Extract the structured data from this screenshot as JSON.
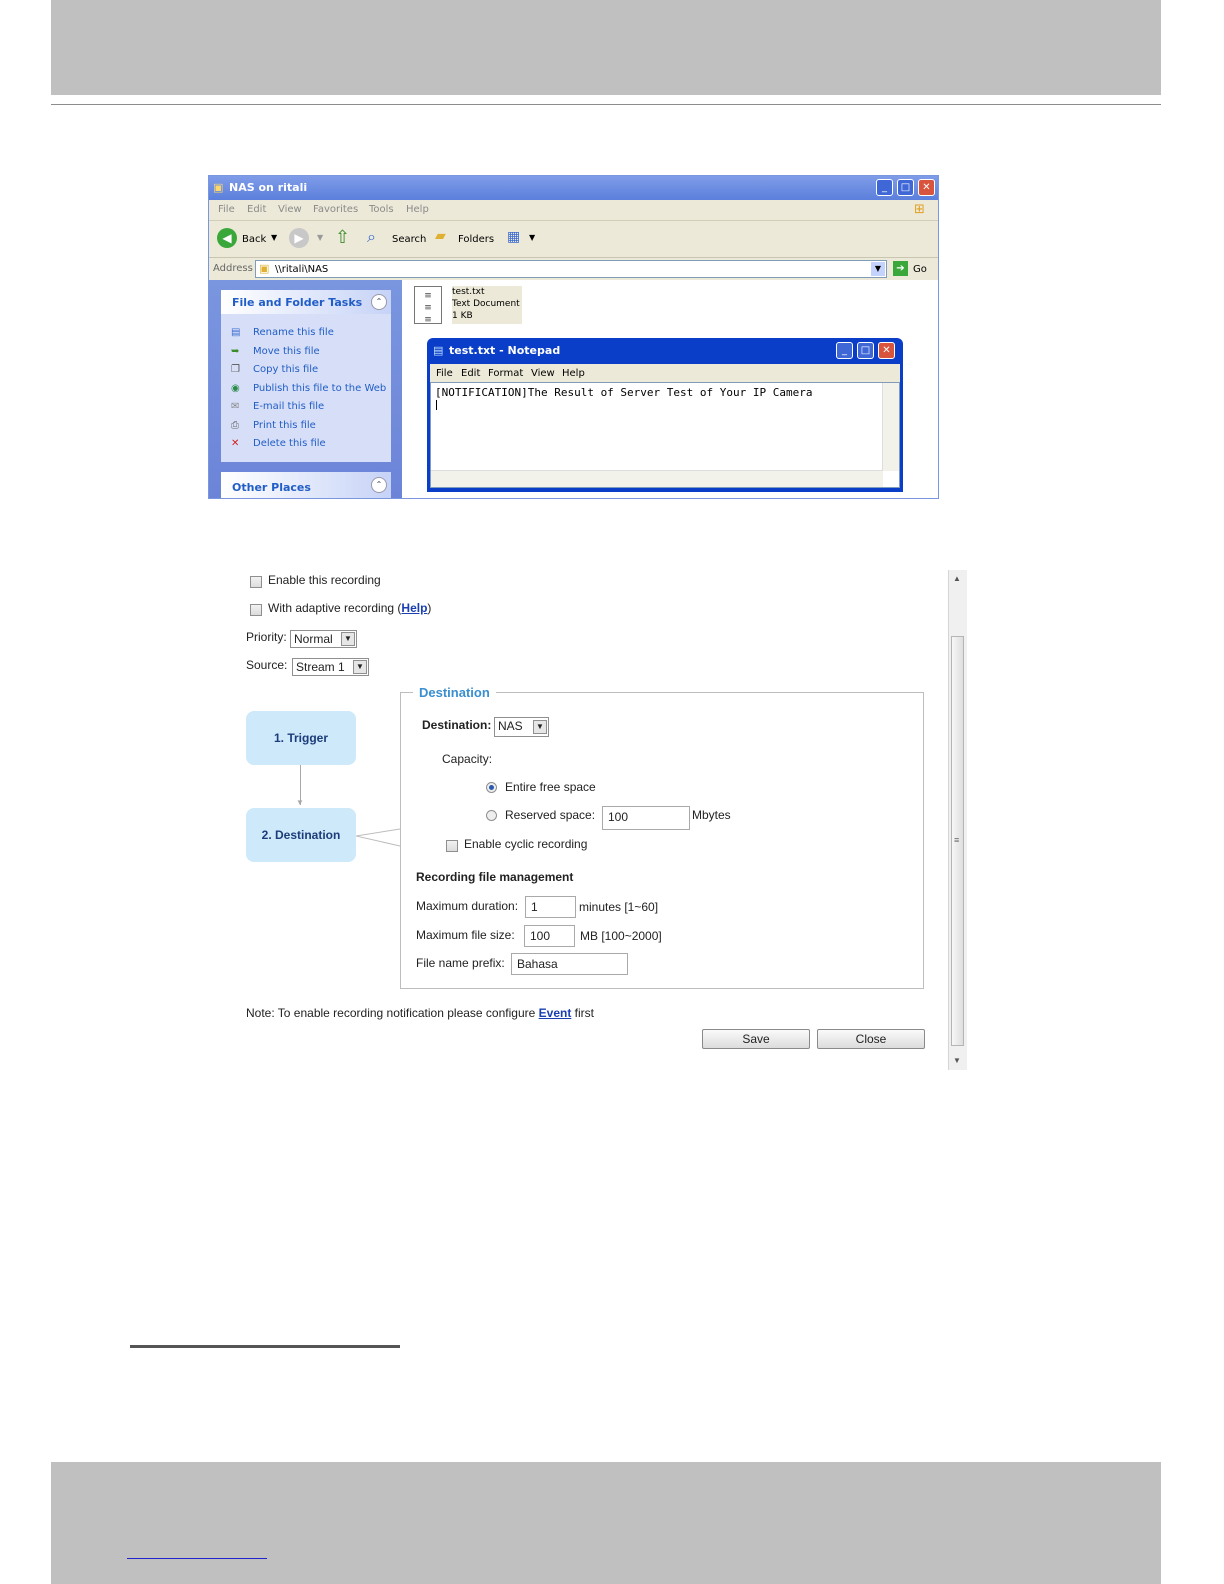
{
  "explorer": {
    "title": "NAS on ritali",
    "menu": [
      "File",
      "Edit",
      "View",
      "Favorites",
      "Tools",
      "Help"
    ],
    "toolbar": {
      "back": "Back",
      "search": "Search",
      "folders": "Folders"
    },
    "address": {
      "label": "Address",
      "value": "\\\\ritali\\NAS",
      "go": "Go"
    },
    "tasks": {
      "heading": "File and Folder Tasks",
      "items": [
        {
          "label": "Rename this file",
          "icon": "rename-icon"
        },
        {
          "label": "Move this file",
          "icon": "move-icon"
        },
        {
          "label": "Copy this file",
          "icon": "copy-icon"
        },
        {
          "label": "Publish this file to the Web",
          "icon": "globe-icon"
        },
        {
          "label": "E-mail this file",
          "icon": "email-icon"
        },
        {
          "label": "Print this file",
          "icon": "print-icon"
        },
        {
          "label": "Delete this file",
          "icon": "delete-icon"
        }
      ]
    },
    "other_places": "Other Places",
    "file": {
      "name": "test.txt",
      "type": "Text Document",
      "size": "1 KB"
    }
  },
  "notepad": {
    "title": "test.txt - Notepad",
    "menu": [
      "File",
      "Edit",
      "Format",
      "View",
      "Help"
    ],
    "content": "[NOTIFICATION]The Result of Server Test of Your IP Camera"
  },
  "recording": {
    "enable_label": "Enable this recording",
    "adaptive_label": "With adaptive recording (",
    "adaptive_help": "Help",
    "adaptive_close": ")",
    "priority_label": "Priority:",
    "priority_value": "Normal",
    "source_label": "Source:",
    "source_value": "Stream 1",
    "steps": [
      "1.  Trigger",
      "2.  Destination"
    ],
    "destination_legend": "Destination",
    "destination_label": "Destination:",
    "destination_value": "NAS",
    "capacity_label": "Capacity:",
    "entire_free_space": "Entire free space",
    "reserved_space": "Reserved space:",
    "reserved_value": "100",
    "reserved_unit": "Mbytes",
    "cyclic_label": "Enable cyclic recording",
    "file_mgmt_heading": "Recording file management",
    "max_duration_label": "Maximum duration:",
    "max_duration_value": "1",
    "max_duration_unit": "minutes [1~60]",
    "max_size_label": "Maximum file size:",
    "max_size_value": "100",
    "max_size_unit": "MB [100~2000]",
    "prefix_label": "File name prefix:",
    "prefix_value": "Bahasa",
    "note_prefix": "Note: To enable recording notification please configure ",
    "note_link": "Event",
    "note_suffix": " first",
    "save": "Save",
    "close": "Close"
  },
  "colors": {
    "accent": "#3a8fd0",
    "step_bg": "#cde9fa",
    "xp_blue": "#0b3ec8"
  }
}
